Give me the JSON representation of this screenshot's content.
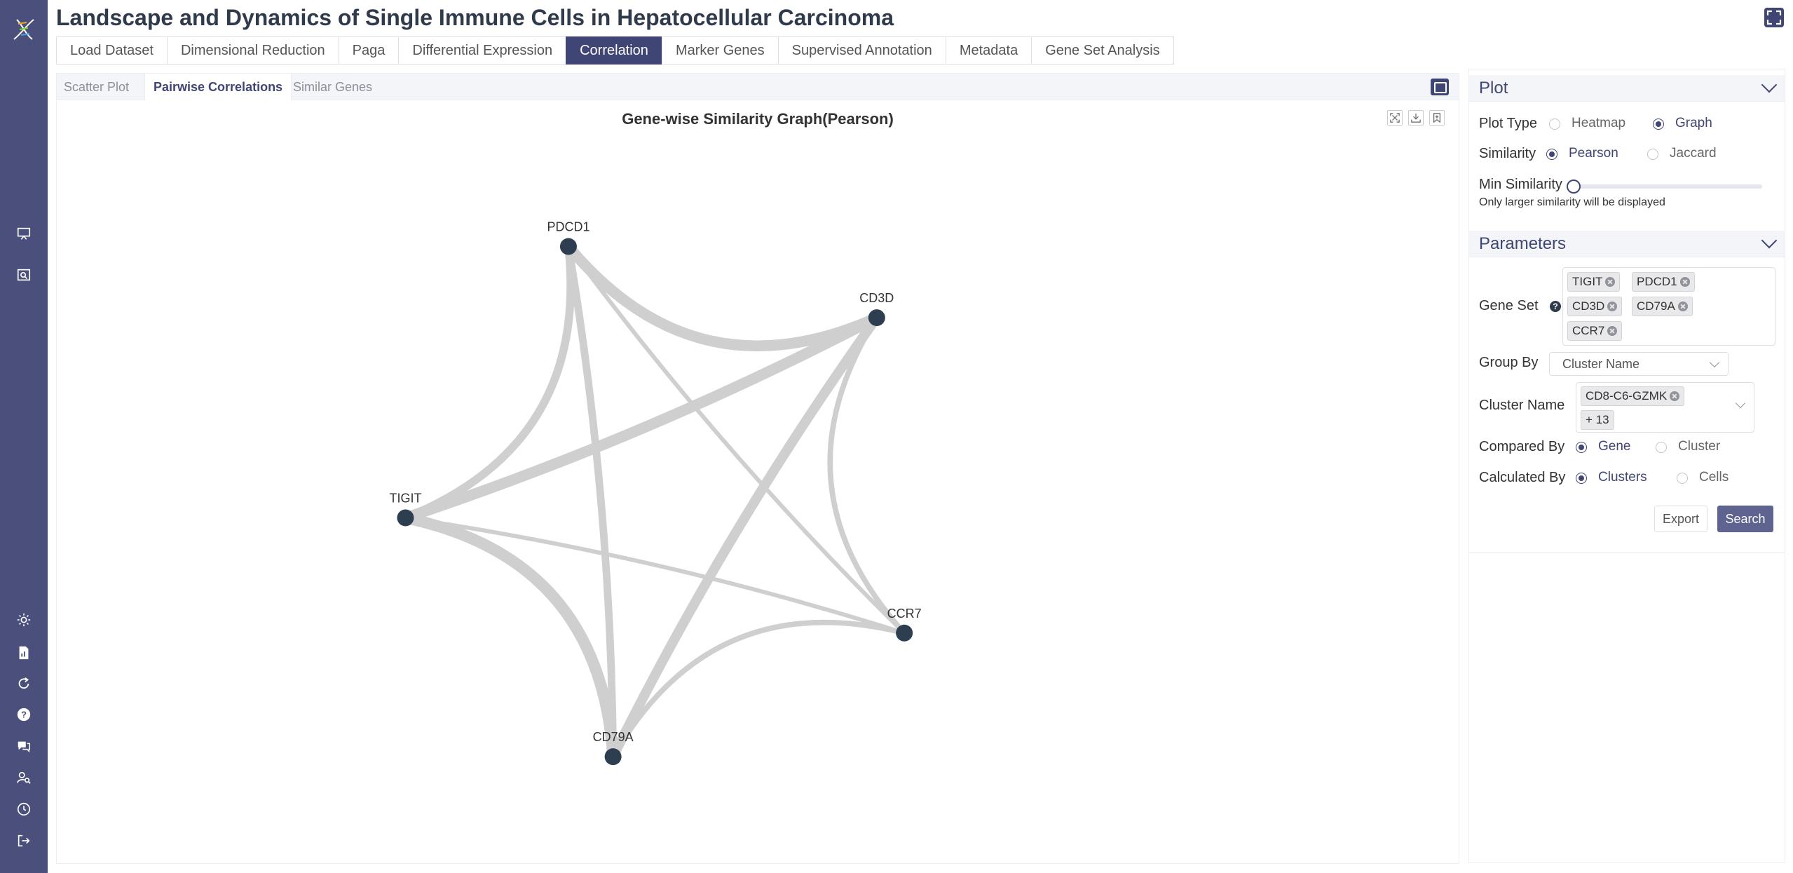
{
  "header": {
    "title": "Landscape and Dynamics of Single Immune Cells in Hepatocellular Carcinoma"
  },
  "tabs": [
    {
      "label": "Load Dataset"
    },
    {
      "label": "Dimensional Reduction"
    },
    {
      "label": "Paga"
    },
    {
      "label": "Differential Expression"
    },
    {
      "label": "Correlation"
    },
    {
      "label": "Marker Genes"
    },
    {
      "label": "Supervised Annotation"
    },
    {
      "label": "Metadata"
    },
    {
      "label": "Gene Set Analysis"
    }
  ],
  "active_tab": "Correlation",
  "subtabs": [
    {
      "label": "Scatter Plot"
    },
    {
      "label": "Pairwise Correlations"
    },
    {
      "label": "Similar Genes"
    }
  ],
  "active_subtab": "Pairwise Correlations",
  "graph": {
    "title": "Gene-wise Similarity Graph(Pearson)",
    "nodes": [
      {
        "id": "PDCD1"
      },
      {
        "id": "CD3D"
      },
      {
        "id": "TIGIT"
      },
      {
        "id": "CCR7"
      },
      {
        "id": "CD79A"
      }
    ],
    "edges": [
      {
        "source": "PDCD1",
        "target": "CD3D",
        "weight": 0.85
      },
      {
        "source": "PDCD1",
        "target": "TIGIT",
        "weight": 0.6
      },
      {
        "source": "PDCD1",
        "target": "CD79A",
        "weight": 0.55
      },
      {
        "source": "PDCD1",
        "target": "CCR7",
        "weight": 0.25
      },
      {
        "source": "TIGIT",
        "target": "CD3D",
        "weight": 0.85
      },
      {
        "source": "TIGIT",
        "target": "CD79A",
        "weight": 0.9
      },
      {
        "source": "TIGIT",
        "target": "CCR7",
        "weight": 0.25
      },
      {
        "source": "CD3D",
        "target": "CD79A",
        "weight": 0.75
      },
      {
        "source": "CD3D",
        "target": "CCR7",
        "weight": 0.35
      },
      {
        "source": "CD79A",
        "target": "CCR7",
        "weight": 0.35
      }
    ]
  },
  "plot_section": {
    "heading": "Plot",
    "plot_type_label": "Plot Type",
    "plot_type_options": [
      "Heatmap",
      "Graph"
    ],
    "plot_type_selected": "Graph",
    "similarity_label": "Similarity",
    "similarity_options": [
      "Pearson",
      "Jaccard"
    ],
    "similarity_selected": "Pearson",
    "min_similarity_label": "Min Similarity",
    "min_similarity_value": 0,
    "hint": "Only larger similarity will be displayed"
  },
  "params_section": {
    "heading": "Parameters",
    "gene_set_label": "Gene Set",
    "gene_set": [
      "TIGIT",
      "PDCD1",
      "CD3D",
      "CD79A",
      "CCR7"
    ],
    "group_by_label": "Group By",
    "group_by_value": "Cluster Name",
    "cluster_name_label": "Cluster Name",
    "cluster_name_tag": "CD8-C6-GZMK",
    "cluster_name_more": "+ 13",
    "compared_by_label": "Compared By",
    "compared_by_options": [
      "Gene",
      "Cluster"
    ],
    "compared_by_selected": "Gene",
    "calculated_by_label": "Calculated By",
    "calculated_by_options": [
      "Clusters",
      "Cells"
    ],
    "calculated_by_selected": "Clusters",
    "export_label": "Export",
    "search_label": "Search"
  },
  "colors": {
    "accent": "#3f4676",
    "rail": "#4a4f7c",
    "node": "#2c3e50",
    "edge": "#cfcfcf"
  }
}
